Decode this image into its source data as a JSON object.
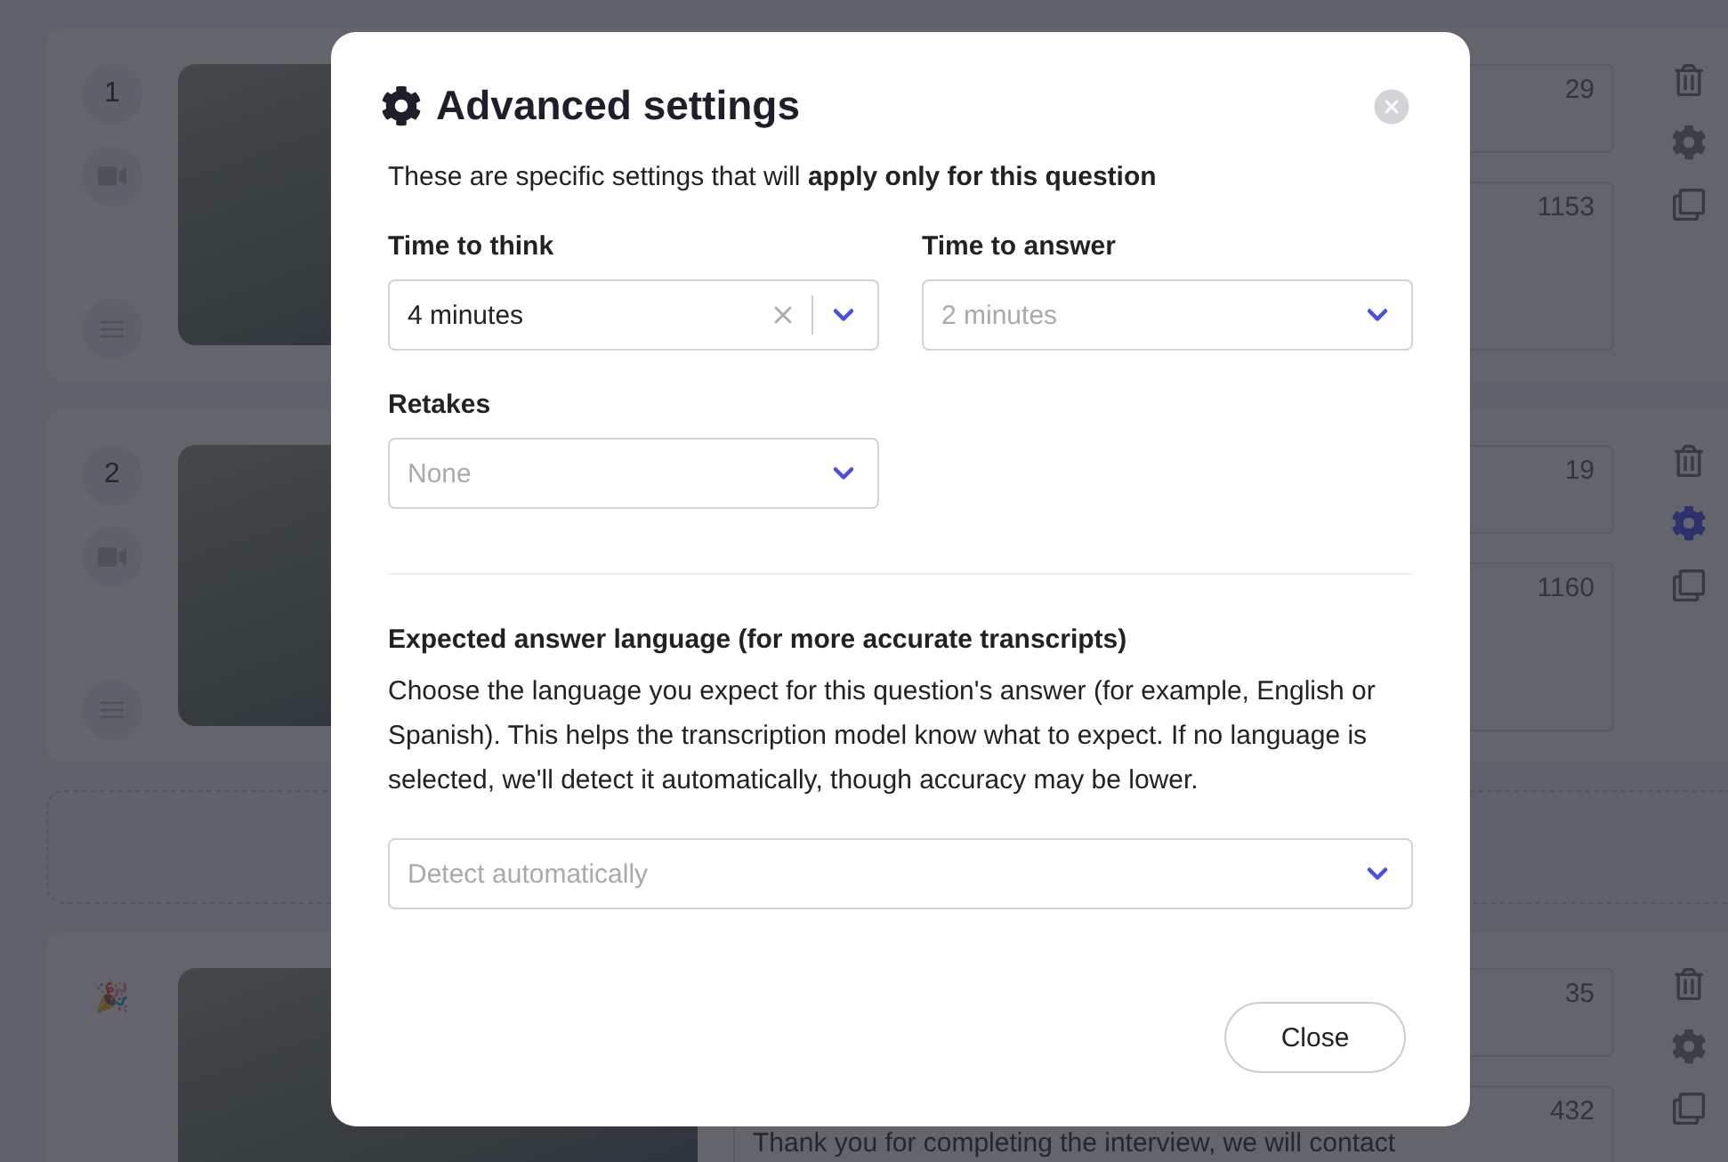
{
  "questions": [
    {
      "kind": "number",
      "marker": "1",
      "title_count": "29",
      "body_count": "1153",
      "settings_active": false
    },
    {
      "kind": "number",
      "marker": "2",
      "title_count": "19",
      "body_count": "1160",
      "settings_active": true
    },
    {
      "kind": "ending",
      "marker": "🎉",
      "title_count": "35",
      "body_count": "432",
      "settings_active": false,
      "body": "Thank you for completing the interview, we will contact"
    }
  ],
  "dialog": {
    "title": "Advanced settings",
    "intro": "These are specific settings that will **apply only for this question**",
    "fields": [
      {
        "label": "Time to think",
        "value": "4 minutes",
        "clearable": true
      },
      {
        "label": "Time to answer",
        "placeholder": "2 minutes",
        "clearable": false
      },
      {
        "label": "Retakes",
        "placeholder": "None",
        "clearable": false
      }
    ],
    "language": {
      "heading": "Expected answer language (for more accurate transcripts)",
      "description": "Choose the language you expect for this question's answer (for example, English or Spanish). This helps the transcription model know what to expect. If no language is selected, we'll detect it automatically, though accuracy may be lower.",
      "placeholder": "Detect automatically"
    },
    "close_button": "Close"
  }
}
